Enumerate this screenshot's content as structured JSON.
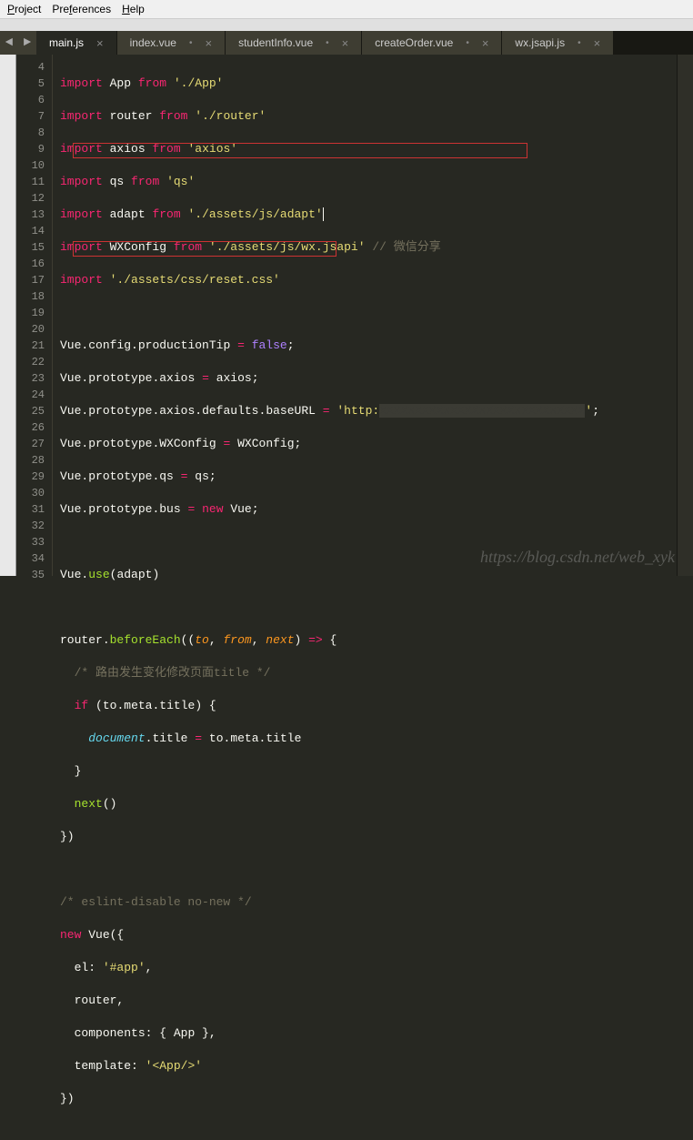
{
  "menu": {
    "project": "Project",
    "preferences": "Preferences",
    "help": "Help"
  },
  "nav": {
    "back": "◄",
    "forward": "►"
  },
  "tabs": [
    {
      "label": "main.js",
      "active": true,
      "closable": true
    },
    {
      "label": "index.vue",
      "active": false,
      "closable": true
    },
    {
      "label": "studentInfo.vue",
      "active": false,
      "closable": true
    },
    {
      "label": "createOrder.vue",
      "active": false,
      "closable": true
    },
    {
      "label": "wx.jsapi.js",
      "active": false,
      "closable": true
    }
  ],
  "lineNumbers": [
    "4",
    "5",
    "6",
    "7",
    "8",
    "9",
    "10",
    "11",
    "12",
    "13",
    "14",
    "15",
    "16",
    "17",
    "18",
    "19",
    "20",
    "21",
    "22",
    "23",
    "24",
    "25",
    "26",
    "27",
    "28",
    "29",
    "30",
    "31",
    "32",
    "33",
    "34",
    "35"
  ],
  "code": {
    "l4": {
      "kw": "import",
      "name": "App",
      "from": "from",
      "path": "'./App'"
    },
    "l5": {
      "kw": "import",
      "name": "router",
      "from": "from",
      "path": "'./router'"
    },
    "l6": {
      "kw": "import",
      "name": "axios",
      "from": "from",
      "path": "'axios'"
    },
    "l7": {
      "kw": "import",
      "name": "qs",
      "from": "from",
      "path": "'qs'"
    },
    "l8": {
      "kw": "import",
      "name": "adapt",
      "from": "from",
      "path": "'./assets/js/adapt'"
    },
    "l9": {
      "kw": "import",
      "name": "WXConfig",
      "from": "from",
      "path": "'./assets/js/wx.jsapi'",
      "comment": "// 微信分享"
    },
    "l10": {
      "kw": "import",
      "path": "'./assets/css/reset.css'"
    },
    "l12": {
      "a": "Vue",
      "b": "config",
      "c": "productionTip",
      "rhs": "false"
    },
    "l13": {
      "a": "Vue",
      "b": "prototype",
      "c": "axios",
      "rhs": "axios"
    },
    "l14": {
      "a": "Vue",
      "b": "prototype",
      "c": "axios",
      "d": "defaults",
      "e": "baseURL",
      "rhs": "'http:",
      "tail": "'"
    },
    "l15": {
      "a": "Vue",
      "b": "prototype",
      "c": "WXConfig",
      "rhs": "WXConfig"
    },
    "l16": {
      "a": "Vue",
      "b": "prototype",
      "c": "qs",
      "rhs": "qs"
    },
    "l17": {
      "a": "Vue",
      "b": "prototype",
      "c": "bus",
      "kw": "new",
      "rhs": "Vue"
    },
    "l19": {
      "a": "Vue",
      "fn": "use",
      "arg": "adapt"
    },
    "l21": {
      "a": "router",
      "fn": "beforeEach",
      "p1": "to",
      "p2": "from",
      "p3": "next",
      "arrow": "=>",
      "brace": "{"
    },
    "l22": {
      "comment": "/* 路由发生变化修改页面title */"
    },
    "l23": {
      "kw": "if",
      "a": "to",
      "b": "meta",
      "c": "title",
      "brace": "{"
    },
    "l24": {
      "doc": "document",
      "a": "title",
      "b": "to",
      "c": "meta",
      "d": "title"
    },
    "l25": {
      "brace": "}"
    },
    "l26": {
      "fn": "next",
      "p": "()"
    },
    "l27": {
      "brace": "})"
    },
    "l29": {
      "comment": "/* eslint-disable no-new */"
    },
    "l30": {
      "kw": "new",
      "name": "Vue",
      "brace": "({"
    },
    "l31": {
      "key": "el",
      "val": "'#app'"
    },
    "l32": {
      "val": "router"
    },
    "l33": {
      "key": "components",
      "a": "App"
    },
    "l34": {
      "key": "template",
      "val": "'<App/>'"
    },
    "l35": {
      "brace": "})"
    }
  },
  "watermark": "https://blog.csdn.net/web_xyk",
  "closeGlyph": "×",
  "dotGlyph": "•"
}
